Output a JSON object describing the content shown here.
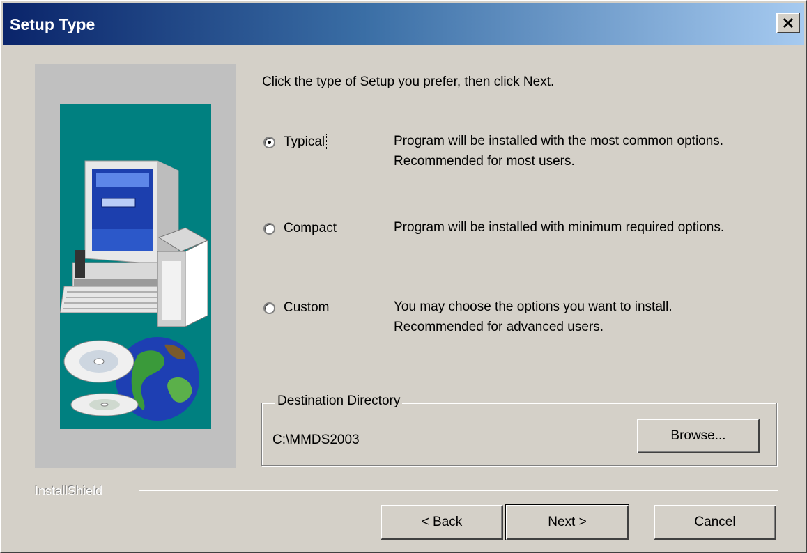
{
  "window": {
    "title": "Setup Type"
  },
  "instruction": "Click the type of Setup you prefer, then click Next.",
  "options": [
    {
      "label": "Typical",
      "checked": true,
      "description": "Program will be installed with the most common options. Recommended for most users."
    },
    {
      "label": "Compact",
      "checked": false,
      "description": "Program will be installed with minimum required options."
    },
    {
      "label": "Custom",
      "checked": false,
      "description": "You may choose the options you want to install. Recommended for advanced users."
    }
  ],
  "destination": {
    "legend": "Destination Directory",
    "path": "C:\\MMDS2003",
    "browse_label": "Browse..."
  },
  "brand": "InstallShield",
  "buttons": {
    "back": "< Back",
    "next": "Next >",
    "cancel": "Cancel"
  },
  "colors": {
    "face": "#d4d0c8",
    "title_start": "#0a246a",
    "title_end": "#a6caf0",
    "art_teal": "#008080"
  }
}
